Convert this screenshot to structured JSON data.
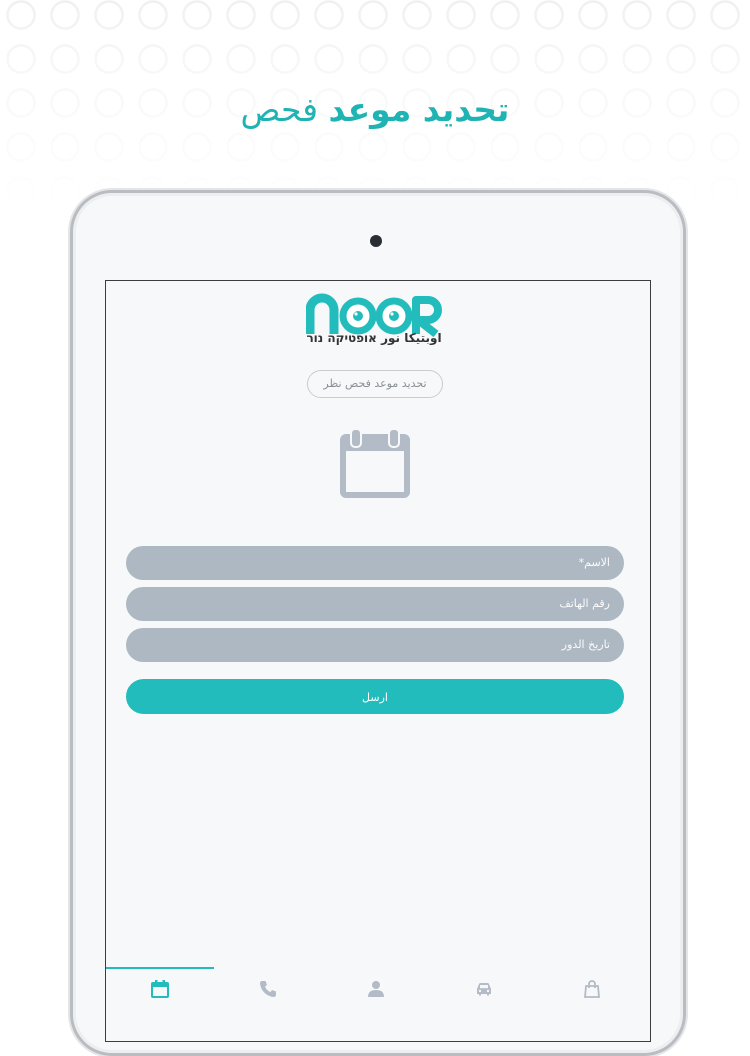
{
  "headline": {
    "bold": "تحديد موعد",
    "light": "فحص"
  },
  "app": {
    "logo_word": "NOOR",
    "logo_subtitle": "اوبتيكا نور  אופטיקה נור",
    "pill_label": "تحديد موعد فحص نظر"
  },
  "form": {
    "name_placeholder": "الاسم*",
    "phone_placeholder": "رقم الهاتف",
    "date_placeholder": "تاريخ الدور",
    "submit_label": "ارسل"
  },
  "colors": {
    "accent": "#22bcbc",
    "field_bg": "#aeb8c2",
    "icon_gray": "#b3bcc6"
  },
  "tabs": [
    {
      "icon": "calendar-icon",
      "active": true
    },
    {
      "icon": "phone-icon",
      "active": false
    },
    {
      "icon": "user-icon",
      "active": false
    },
    {
      "icon": "car-icon",
      "active": false
    },
    {
      "icon": "shopping-bag-icon",
      "active": false
    }
  ]
}
